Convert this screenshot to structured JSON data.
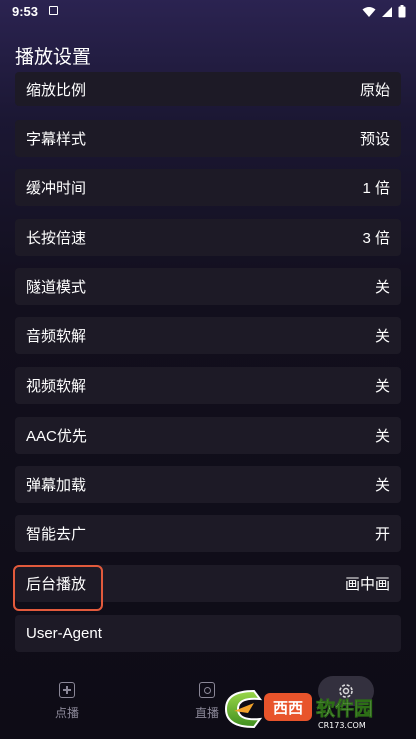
{
  "status_bar": {
    "time": "9:53"
  },
  "header": {
    "title": "播放设置"
  },
  "settings": [
    {
      "label": "缩放比例",
      "value": "原始"
    },
    {
      "label": "字幕样式",
      "value": "预设"
    },
    {
      "label": "缓冲时间",
      "value": "1 倍"
    },
    {
      "label": "长按倍速",
      "value": "3 倍"
    },
    {
      "label": "隧道模式",
      "value": "关"
    },
    {
      "label": "音频软解",
      "value": "关"
    },
    {
      "label": "视频软解",
      "value": "关"
    },
    {
      "label": "AAC优先",
      "value": "关"
    },
    {
      "label": "弹幕加载",
      "value": "关"
    },
    {
      "label": "智能去广",
      "value": "开"
    },
    {
      "label": "后台播放",
      "value": "画中画"
    },
    {
      "label": "User-Agent",
      "value": ""
    }
  ],
  "bottom_nav": {
    "items": [
      {
        "label": "点播",
        "icon": "add-box-icon"
      },
      {
        "label": "直播",
        "icon": "camera-icon"
      },
      {
        "label": "",
        "icon": "gear-icon"
      }
    ]
  },
  "watermark": {
    "text": "西西软件园",
    "url_text": "CR173.COM"
  },
  "colors": {
    "highlight": "#e25a3c",
    "row_bg": "#1d1a26",
    "header_bg": "#2b2351"
  }
}
